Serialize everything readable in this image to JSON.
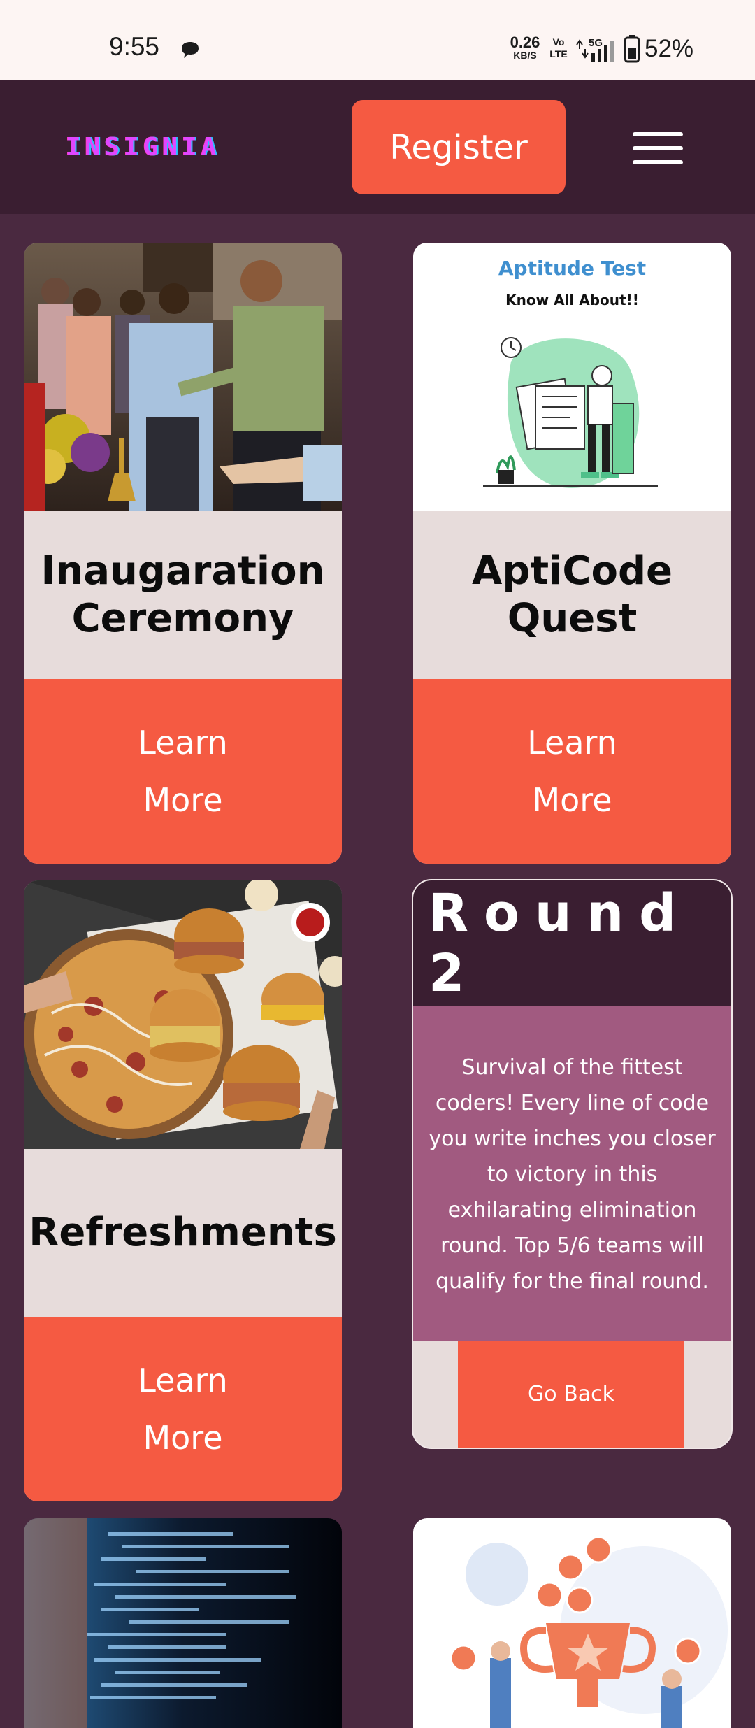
{
  "status_bar": {
    "time": "9:55",
    "net_speed_value": "0.26",
    "net_speed_unit": "KB/S",
    "volte_top": "Vo",
    "volte_bottom": "LTE",
    "network_type": "5G",
    "battery_percent": "52%"
  },
  "header": {
    "logo_text": "INSIGNIA",
    "register_label": "Register",
    "menu_icon": "hamburger-menu-icon"
  },
  "cards": [
    {
      "title": "Inaugaration Ceremony",
      "button": "Learn More",
      "image": "inauguration-lamp-lighting-photo"
    },
    {
      "title": "AptiCode Quest",
      "button": "Learn More",
      "image": "aptitude-test-illustration",
      "image_heading": "Aptitude Test",
      "image_subheading": "Know All About!!"
    },
    {
      "title": "Refreshments",
      "button": "Learn More",
      "image": "pizza-and-burgers-photo"
    }
  ],
  "round_card": {
    "title": "Round 2",
    "description": "Survival of the fittest coders! Every line of code you write inches you closer to victory in this exhilarating elimination round. Top 5/6 teams will qualify for the final round.",
    "button": "Go Back"
  },
  "partial_cards": [
    {
      "image": "code-screen-photo"
    },
    {
      "image": "trophy-coins-illustration"
    }
  ],
  "colors": {
    "page_bg": "#4a2940",
    "header_bg": "#3a1e31",
    "accent": "#f55a42",
    "card_bg": "#e7dcdb",
    "round_body": "#a15a80"
  }
}
